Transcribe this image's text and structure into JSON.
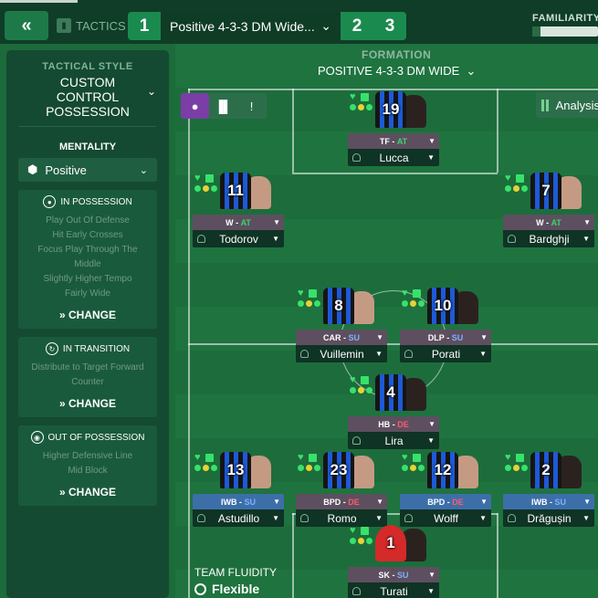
{
  "topbar": {
    "back_icon": "double-chevron-left-icon",
    "tactics_label": "TACTICS",
    "slots": [
      "1",
      "2",
      "3"
    ],
    "active_slot_name": "Positive 4-3-3 DM Wide...",
    "familiarity_label": "FAMILIARITY",
    "familiarity_level": 0.12
  },
  "sidebar": {
    "style_label": "TACTICAL STYLE",
    "style_value": "CUSTOM CONTROL POSSESSION",
    "mentality_label": "MENTALITY",
    "mentality_value": "Positive",
    "in_possession": {
      "title": "IN POSSESSION",
      "lines": [
        "Play Out Of Defense",
        "Hit Early Crosses",
        "Focus Play Through The Middle",
        "Slightly Higher Tempo",
        "Fairly Wide"
      ],
      "change": "CHANGE"
    },
    "in_transition": {
      "title": "IN TRANSITION",
      "lines": [
        "Distribute to Target Forward",
        "Counter"
      ],
      "change": "CHANGE"
    },
    "out_of_possession": {
      "title": "OUT OF POSSESSION",
      "lines": [
        "Higher Defensive Line",
        "Mid Block"
      ],
      "change": "CHANGE"
    },
    "fluidity_label": "TEAM FLUIDITY",
    "fluidity_value": "Flexible"
  },
  "pitch": {
    "formation_label": "FORMATION",
    "formation_name": "POSITIVE 4-3-3 DM WIDE",
    "analysis_label": "Analysis",
    "players": [
      {
        "number": "19",
        "role": "TF",
        "duty": "AT",
        "name": "Lucca"
      },
      {
        "number": "11",
        "role": "W",
        "duty": "AT",
        "name": "Todorov"
      },
      {
        "number": "7",
        "role": "W",
        "duty": "AT",
        "name": "Bardghji"
      },
      {
        "number": "8",
        "role": "CAR",
        "duty": "SU",
        "name": "Vuillemin"
      },
      {
        "number": "10",
        "role": "DLP",
        "duty": "SU",
        "name": "Porati"
      },
      {
        "number": "4",
        "role": "HB",
        "duty": "DE",
        "name": "Lira"
      },
      {
        "number": "13",
        "role": "IWB",
        "duty": "SU",
        "name": "Astudillo"
      },
      {
        "number": "23",
        "role": "BPD",
        "duty": "DE",
        "name": "Romo"
      },
      {
        "number": "12",
        "role": "BPD",
        "duty": "DE",
        "name": "Wolff"
      },
      {
        "number": "2",
        "role": "IWB",
        "duty": "SU",
        "name": "Drăgușin"
      },
      {
        "number": "1",
        "role": "SK",
        "duty": "SU",
        "name": "Turati"
      }
    ]
  },
  "colors": {
    "topbar_bg": "#0f3d27",
    "pitch_green": "#1f733f",
    "attack_duty": "#3bd56d",
    "support_duty": "#7fb0ff",
    "defend_duty": "#ff5a6e",
    "role_bar_default": "#5d4f5f",
    "role_bar_selected": "#3c6fa8"
  }
}
